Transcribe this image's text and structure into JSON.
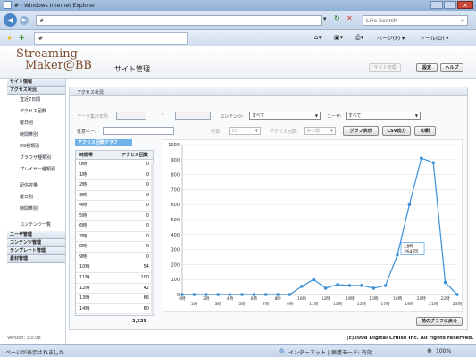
{
  "browser": {
    "title": "# - Windows Internet Explorer",
    "address": "#",
    "search_placeholder": "Live Search",
    "tab_title": "#",
    "page_menu": "ページ(P) ▾",
    "tools_menu": "ツール(O) ▾"
  },
  "header": {
    "logo_line1": "Streaming",
    "logo_line2": "Maker@BB",
    "page_title": "サイト管理",
    "btn_site": "サイト管理",
    "btn_settings": "設定",
    "btn_help": "ヘルプ"
  },
  "sidebar": {
    "sections": [
      {
        "label": "サイト情報",
        "items": []
      },
      {
        "label": "アクセス状況",
        "items": [
          "直近7日間",
          "アクセス回数",
          "曜日別",
          "時間帯別",
          "OS種類別",
          "ブラウザ種類別",
          "プレイヤー種類別",
          "配信容量",
          "曜日別",
          "時間帯別",
          "コンテンツ一覧"
        ]
      },
      {
        "label": "ユーザ管理",
        "items": []
      },
      {
        "label": "コンテンツ管理",
        "items": []
      },
      {
        "label": "テンプレート管理",
        "items": []
      },
      {
        "label": "素材管理",
        "items": []
      }
    ],
    "version": "Version: 3.0.0b"
  },
  "panel": {
    "title": "アクセス状況",
    "period_label": "データ集計年月:",
    "content_label": "コンテンツ:",
    "content_value": "すべて",
    "user_label": "ユーザ:",
    "user_value": "すべて",
    "keyword_label": "任意キー:",
    "btn_graph": "グラフ表示",
    "btn_csv": "CSV出力",
    "btn_print": "印刷",
    "small_label1": "件数:",
    "small_value1": "10",
    "small_label2": "アクセス回数:",
    "small_value2": "多い順",
    "table_caption": "アクセス回数グラフ",
    "col_time": "時間帯",
    "col_count": "アクセス回数",
    "total": "3,239",
    "btn_back": "前のグラフに戻る"
  },
  "table_rows": [
    [
      "0時",
      "0"
    ],
    [
      "1時",
      "0"
    ],
    [
      "2時",
      "0"
    ],
    [
      "3時",
      "0"
    ],
    [
      "4時",
      "0"
    ],
    [
      "5時",
      "0"
    ],
    [
      "6時",
      "0"
    ],
    [
      "7時",
      "0"
    ],
    [
      "8時",
      "0"
    ],
    [
      "9時",
      "0"
    ],
    [
      "10時",
      "54"
    ],
    [
      "11時",
      "100"
    ],
    [
      "12時",
      "42"
    ],
    [
      "13時",
      "66"
    ],
    [
      "14時",
      "60"
    ]
  ],
  "chart_data": {
    "type": "line",
    "categories": [
      "0時",
      "1時",
      "2時",
      "3時",
      "4時",
      "5時",
      "6時",
      "7時",
      "8時",
      "9時",
      "10時",
      "11時",
      "12時",
      "13時",
      "14時",
      "15時",
      "16時",
      "17時",
      "18時",
      "19時",
      "20時",
      "21時",
      "22時",
      "23時"
    ],
    "values": [
      0,
      0,
      0,
      0,
      0,
      0,
      0,
      0,
      0,
      0,
      54,
      100,
      42,
      66,
      60,
      60,
      42,
      60,
      264,
      600,
      910,
      880,
      80,
      0
    ],
    "ylim": [
      0,
      1000
    ],
    "yticks": [
      0,
      100,
      200,
      300,
      400,
      500,
      600,
      700,
      800,
      900,
      1000
    ],
    "tooltip_line1": "18時",
    "tooltip_line2": "264 回",
    "color": "#3a8fd8"
  },
  "footer": {
    "copyright": "(c)2008 Digital Cruise Inc. All rights reserved."
  },
  "status": {
    "text": "ページが表示されました",
    "zone": "インターネット | 保護モード: 有効",
    "zoom": "100%"
  }
}
